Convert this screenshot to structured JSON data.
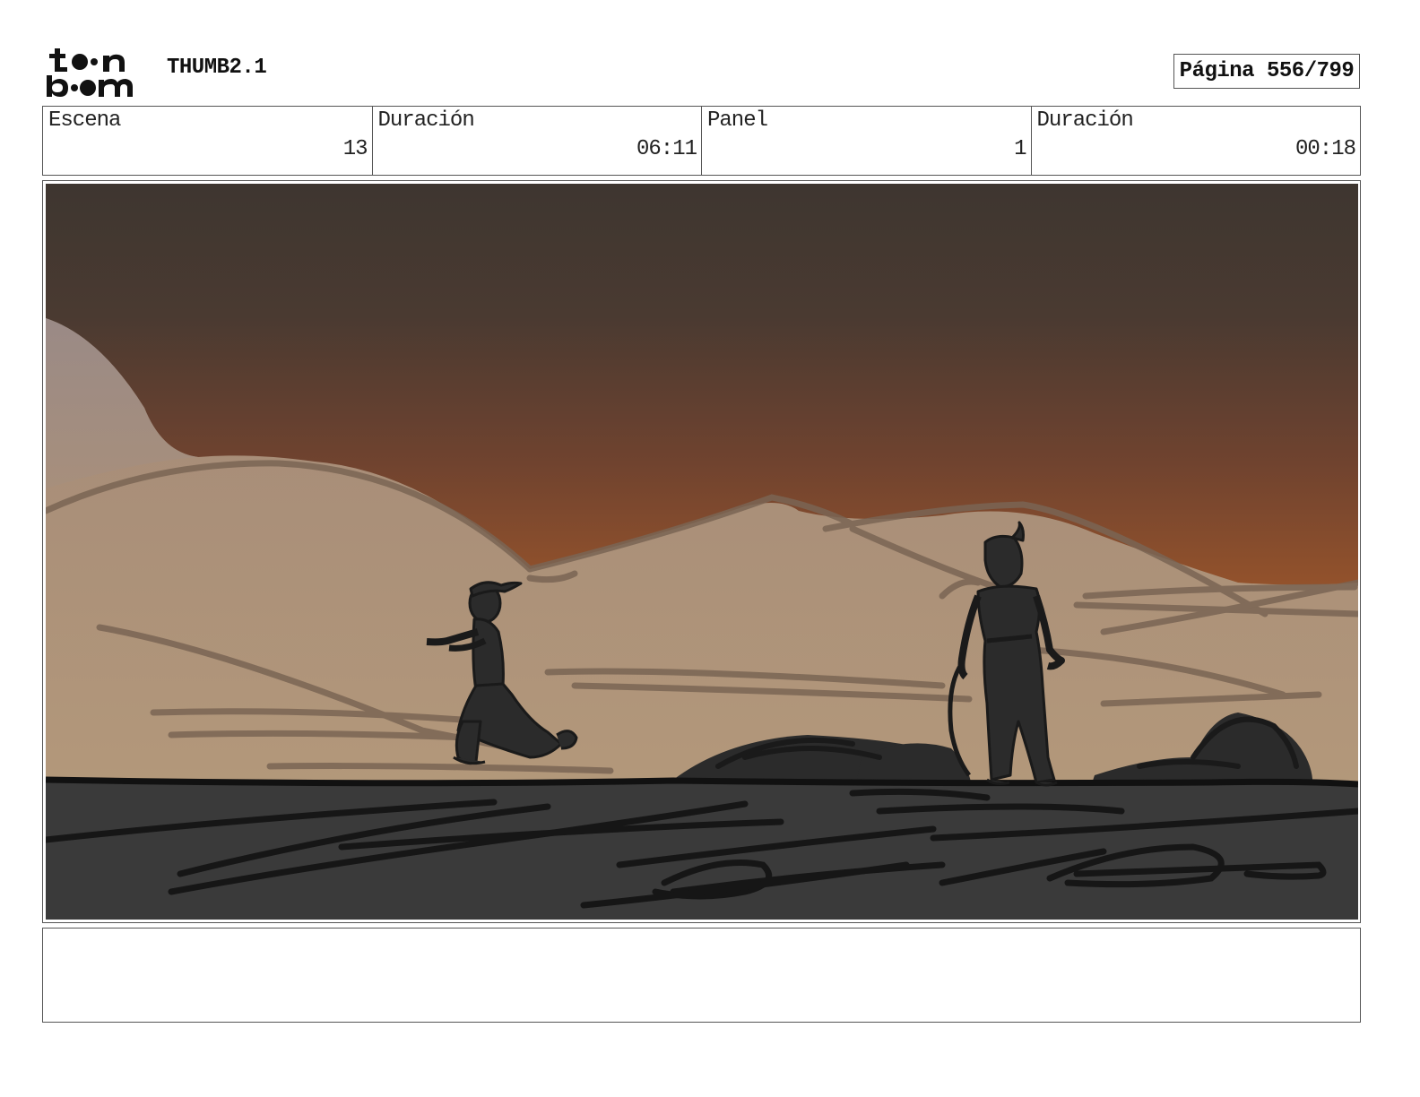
{
  "header": {
    "brand": "toon boom",
    "title": "THUMB2.1",
    "page": "Página 556/799"
  },
  "info": {
    "scene_label": "Escena",
    "scene_value": "13",
    "scene_duration_label": "Duración",
    "scene_duration_value": "06:11",
    "panel_label": "Panel",
    "panel_value": "1",
    "panel_duration_label": "Duración",
    "panel_duration_value": "00:18"
  },
  "panel": {
    "description": "",
    "colors": {
      "sky_top": "#3f3630",
      "sky_mid": "#7a4530",
      "sky_horizon": "#b0652a",
      "dunes": "#b09376",
      "ground": "#3a3a3a",
      "silhouette": "#2b2b2b"
    }
  },
  "notes": {
    "text": ""
  }
}
